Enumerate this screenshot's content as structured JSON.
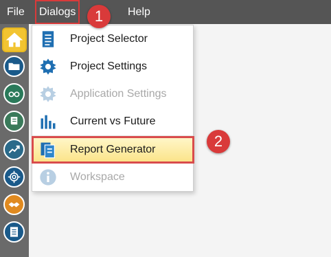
{
  "menubar": {
    "items": [
      {
        "label": "File"
      },
      {
        "label": "Dialogs"
      },
      {
        "label": "ls"
      },
      {
        "label": "Help"
      }
    ]
  },
  "badges": {
    "one": "1",
    "two": "2"
  },
  "sidebar": {
    "items": [
      {
        "icon": "home-icon"
      },
      {
        "icon": "folder-icon"
      },
      {
        "icon": "binoculars-icon"
      },
      {
        "icon": "scroll-icon"
      },
      {
        "icon": "chart-trend-icon"
      },
      {
        "icon": "target-icon"
      },
      {
        "icon": "handshake-icon"
      },
      {
        "icon": "document-list-icon"
      }
    ]
  },
  "dropdown": {
    "items": [
      {
        "label": "Project Selector",
        "icon": "document-icon",
        "enabled": true
      },
      {
        "label": "Project Settings",
        "icon": "gear-icon",
        "enabled": true
      },
      {
        "label": "Application Settings",
        "icon": "gear-icon",
        "enabled": false
      },
      {
        "label": "Current vs Future",
        "icon": "bar-chart-icon",
        "enabled": true
      },
      {
        "label": "Report Generator",
        "icon": "report-icon",
        "enabled": true,
        "selected": true
      },
      {
        "label": "Workspace",
        "icon": "info-icon",
        "enabled": false
      }
    ]
  },
  "colors": {
    "menubar": "#555555",
    "sidebar": "#6a6a6a",
    "highlight": "#d93a3a",
    "icon_blue": "#1a5a8a",
    "selected_bg": "#fbe48a"
  }
}
